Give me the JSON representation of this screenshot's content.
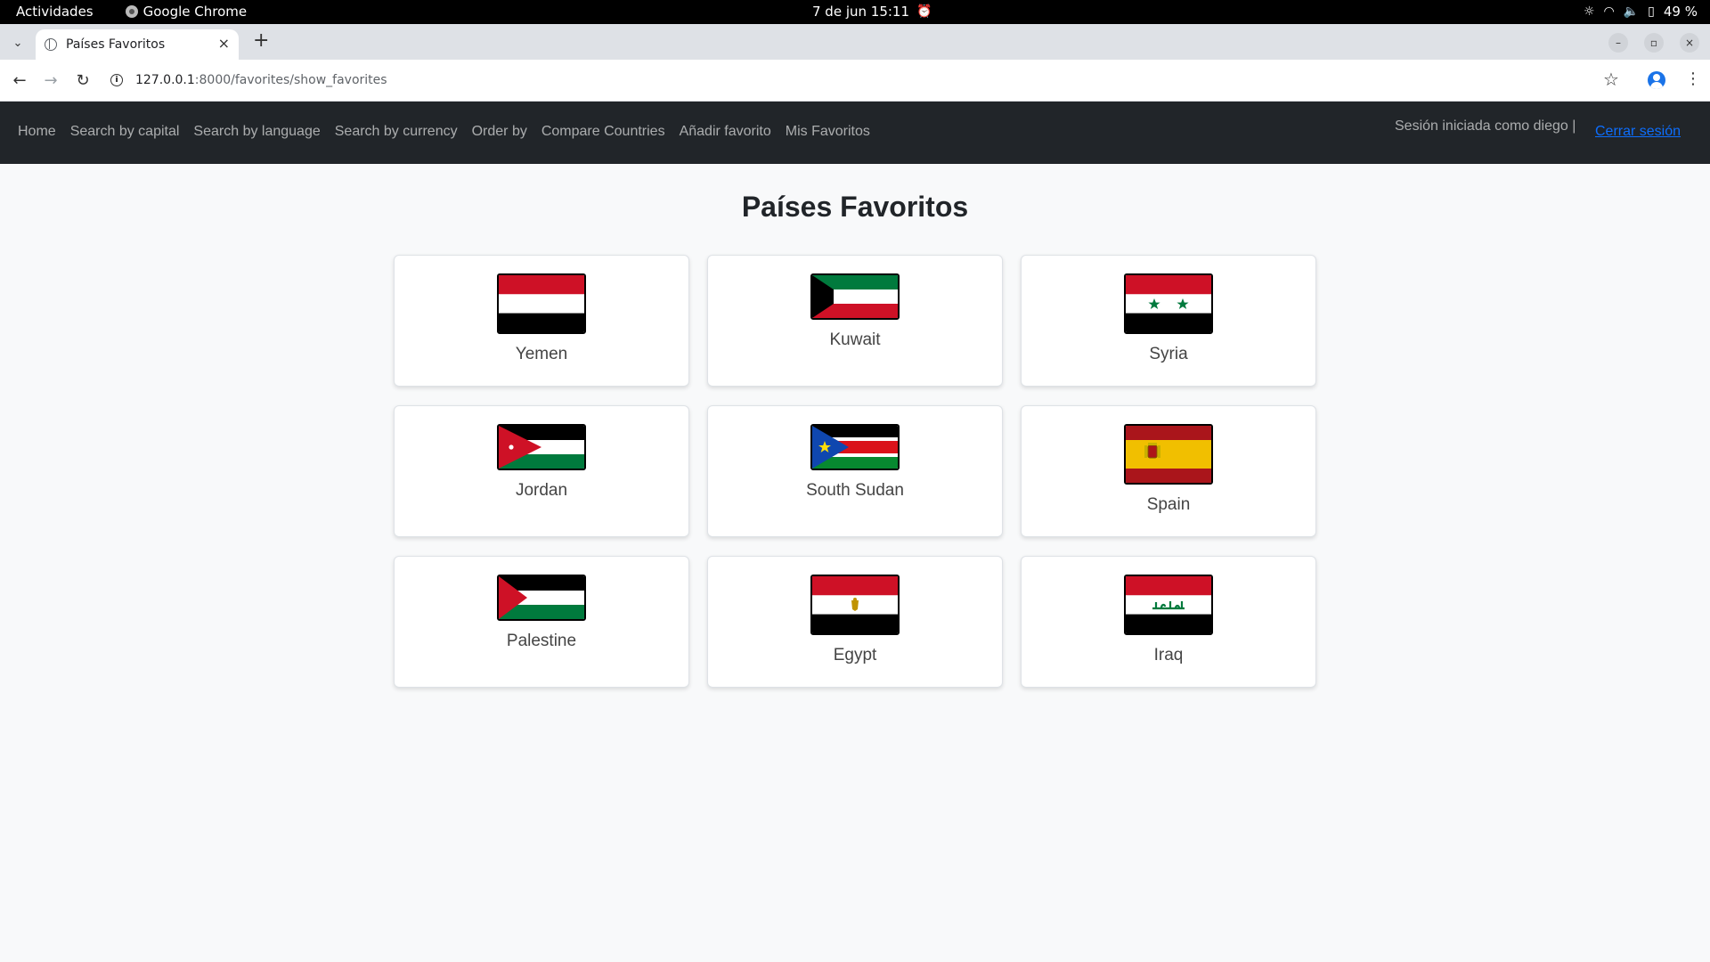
{
  "system_bar": {
    "activities": "Actividades",
    "app_name": "Google Chrome",
    "datetime": "7 de jun  15:11",
    "battery": "49 %"
  },
  "browser": {
    "tab_title": "Países Favoritos",
    "url_host": "127.0.0.1",
    "url_path": ":8000/favorites/show_favorites"
  },
  "navbar": {
    "links": [
      "Home",
      "Search by capital",
      "Search by language",
      "Search by currency",
      "Order by",
      "Compare Countries",
      "Añadir favorito",
      "Mis Favoritos"
    ],
    "session_text": "Sesión iniciada como diego |",
    "logout_label": "Cerrar sesión"
  },
  "page": {
    "title": "Países Favoritos"
  },
  "countries": [
    {
      "name": "Yemen",
      "flag_icon": "yemen-flag"
    },
    {
      "name": "Kuwait",
      "flag_icon": "kuwait-flag"
    },
    {
      "name": "Syria",
      "flag_icon": "syria-flag"
    },
    {
      "name": "Jordan",
      "flag_icon": "jordan-flag"
    },
    {
      "name": "South Sudan",
      "flag_icon": "south-sudan-flag"
    },
    {
      "name": "Spain",
      "flag_icon": "spain-flag"
    },
    {
      "name": "Palestine",
      "flag_icon": "palestine-flag"
    },
    {
      "name": "Egypt",
      "flag_icon": "egypt-flag"
    },
    {
      "name": "Iraq",
      "flag_icon": "iraq-flag"
    }
  ],
  "colors": {
    "navbar_bg": "#212529",
    "logout_link": "#0d6efd",
    "page_bg": "#f8f9fa"
  }
}
